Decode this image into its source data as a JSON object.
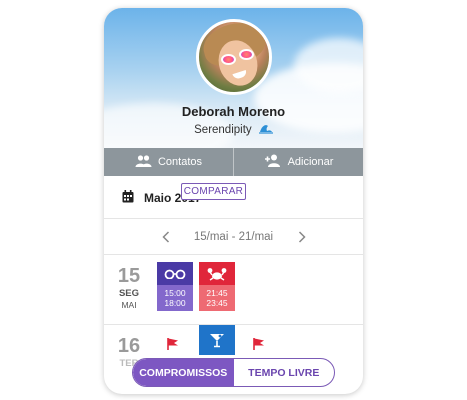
{
  "profile": {
    "name": "Deborah Moreno",
    "status": "Serendipity",
    "status_emoji": "wave-icon"
  },
  "actions": {
    "contacts_label": "Contatos",
    "add_label": "Adicionar"
  },
  "calendar": {
    "month_label": "Maio 2017",
    "compare_label": "COMPARAR",
    "week_range": "15/mai - 21/mai"
  },
  "days": [
    {
      "day": "15",
      "weekday": "SEG",
      "month": "MAI",
      "events": [
        {
          "icon": "sunglasses-icon",
          "start": "15:00",
          "end": "18:00",
          "color": "#4a3aa5"
        },
        {
          "icon": "crab-icon",
          "start": "21:45",
          "end": "23:45",
          "color": "#e0263a"
        }
      ]
    },
    {
      "day": "16",
      "weekday": "TER",
      "events": [
        {
          "icon": "flag-icon",
          "color": "#e0263a"
        },
        {
          "icon": "cocktail-icon",
          "color": "#1f74c9"
        },
        {
          "icon": "flag-icon",
          "color": "#e0263a"
        }
      ]
    }
  ],
  "bottom_toggle": {
    "active_label": "COMPROMISSOS",
    "inactive_label": "TEMPO LIVRE"
  },
  "colors": {
    "accent": "#7d57c2",
    "action_bar": "#8d969c"
  }
}
